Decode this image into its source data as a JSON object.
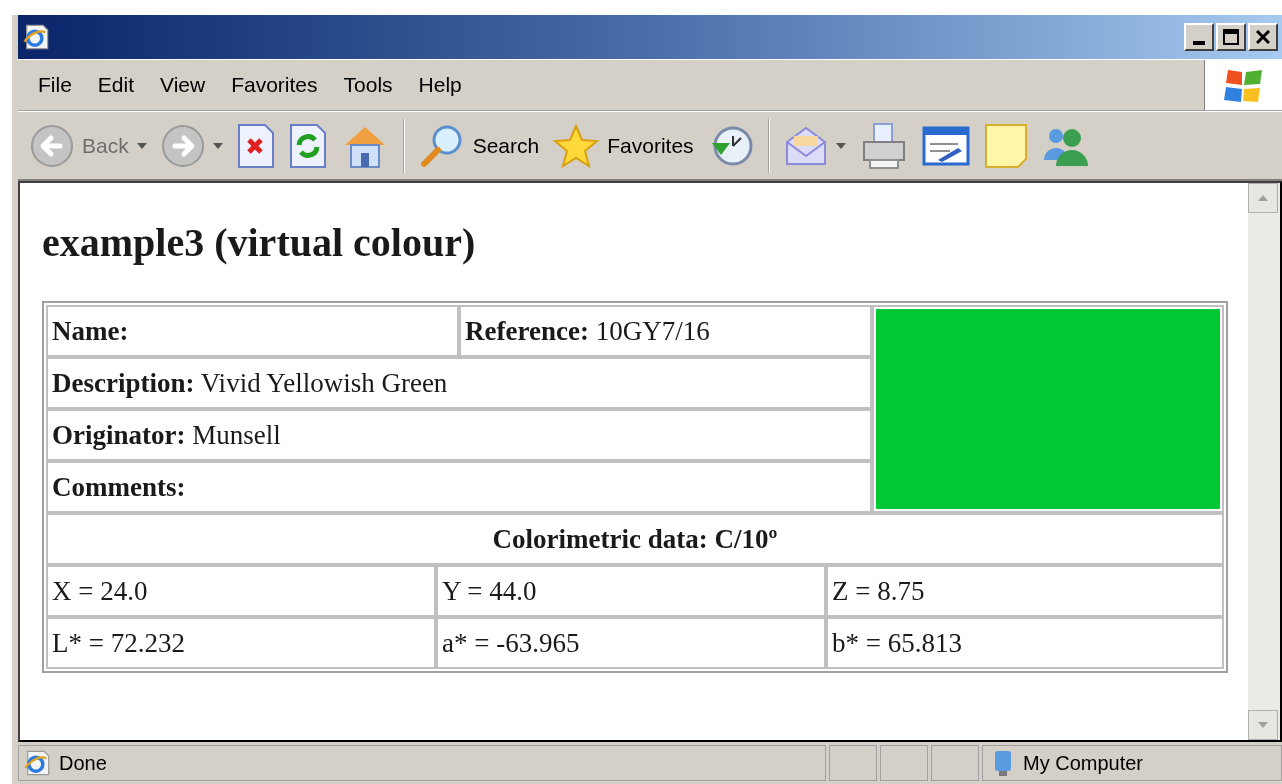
{
  "menu": [
    "File",
    "Edit",
    "View",
    "Favorites",
    "Tools",
    "Help"
  ],
  "toolbar": [
    {
      "kind": "back",
      "label": "Back",
      "disabled": true,
      "dropdown": true
    },
    {
      "kind": "forward",
      "disabled": true,
      "dropdown": true
    },
    {
      "kind": "stop",
      "disabled": false,
      "dropdown": false
    },
    {
      "kind": "refresh",
      "disabled": false,
      "dropdown": false
    },
    {
      "kind": "home",
      "disabled": false,
      "dropdown": false
    },
    {
      "kind": "separator"
    },
    {
      "kind": "search",
      "label": "Search",
      "disabled": false,
      "dropdown": false
    },
    {
      "kind": "favorites",
      "label": "Favorites",
      "disabled": false,
      "dropdown": false
    },
    {
      "kind": "history",
      "disabled": false,
      "dropdown": false
    },
    {
      "kind": "separator"
    },
    {
      "kind": "mail",
      "disabled": false,
      "dropdown": true
    },
    {
      "kind": "print",
      "disabled": false,
      "dropdown": false
    },
    {
      "kind": "edit",
      "disabled": false,
      "dropdown": false
    },
    {
      "kind": "note",
      "disabled": false,
      "dropdown": false
    },
    {
      "kind": "messenger",
      "disabled": false,
      "dropdown": false
    }
  ],
  "page": {
    "heading": "example3 (virtual colour)",
    "fields": [
      [
        {
          "label": "Name:"
        },
        {
          "label": "Reference:",
          "value": "10GY7/16"
        }
      ],
      [
        {
          "label": "Description:",
          "value": "Vivid Yellowish Green"
        }
      ],
      [
        {
          "label": "Originator:",
          "value": "Munsell"
        }
      ],
      [
        {
          "label": "Comments:"
        }
      ]
    ],
    "swatch": {
      "color": "#00c832"
    },
    "colorimetric": {
      "title": "Colorimetric data: C/10º",
      "rows": [
        [
          "X = 24.0",
          "Y = 44.0",
          "Z = 8.75"
        ],
        [
          "L* = 72.232",
          "a* = -63.965",
          "b* = 65.813"
        ]
      ]
    }
  },
  "status_bar": {
    "text": "Done",
    "zone": "My Computer"
  }
}
